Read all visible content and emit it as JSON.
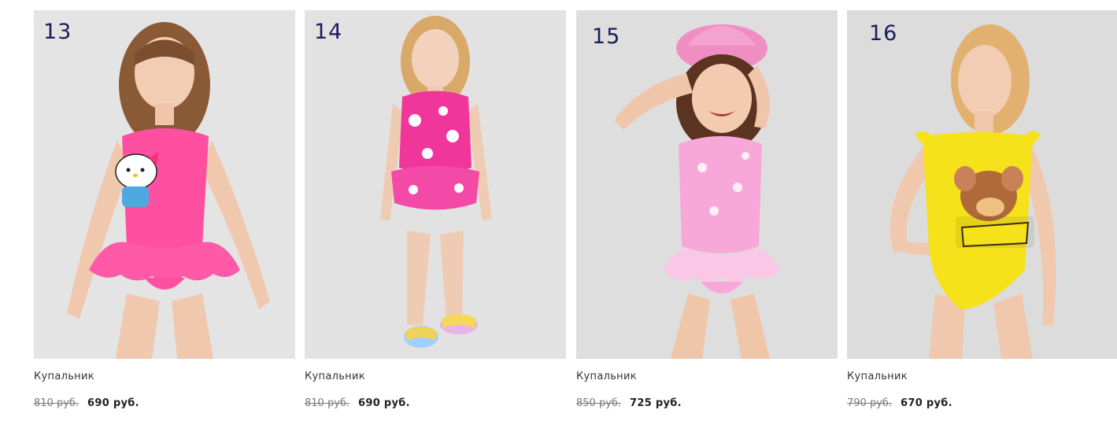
{
  "products": [
    {
      "number": "13",
      "title": "Купальник",
      "old_price": "810 руб.",
      "price": "690 руб.",
      "swimsuit_color": "#ff4fa0",
      "image_subject": "girl in pink ruffled swimsuit with Hello Kitty print"
    },
    {
      "number": "14",
      "title": "Купальник",
      "old_price": "810 руб.",
      "price": "690 руб.",
      "swimsuit_color": "#f0359b",
      "image_subject": "girl in pink Hello Kitty pattern swimsuit with skirt and rainbow slides"
    },
    {
      "number": "15",
      "title": "Купальник",
      "old_price": "850 руб.",
      "price": "725 руб.",
      "swimsuit_color": "#f7a8d8",
      "image_subject": "girl in light pink swimsuit with tulle skirt and pink hat"
    },
    {
      "number": "16",
      "title": "Купальник",
      "old_price": "790 руб.",
      "price": "670 руб.",
      "swimsuit_color": "#f5e21a",
      "image_subject": "girl in yellow Tom and Jerry swimsuit"
    }
  ],
  "colors": {
    "photo_background": "#e3e3e3",
    "number_color": "#1a1d5c",
    "price_color": "#222222",
    "old_price_color": "#7a7a7a"
  }
}
